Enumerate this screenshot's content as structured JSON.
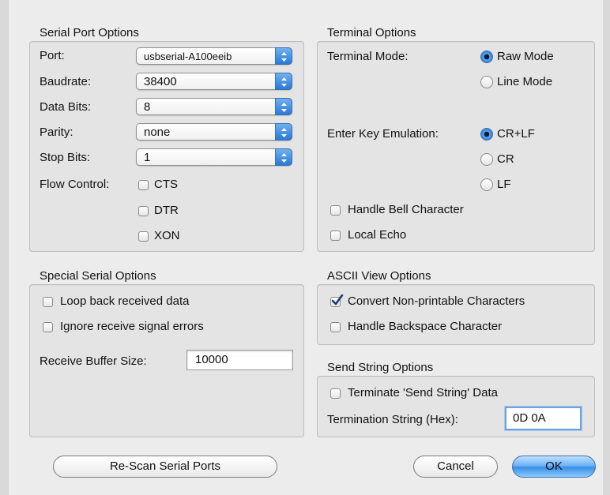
{
  "serial_port": {
    "title": "Serial Port Options",
    "port_label": "Port:",
    "port_value": "usbserial-A100eeib",
    "baudrate_label": "Baudrate:",
    "baudrate_value": "38400",
    "databits_label": "Data Bits:",
    "databits_value": "8",
    "parity_label": "Parity:",
    "parity_value": "none",
    "stopbits_label": "Stop Bits:",
    "stopbits_value": "1",
    "flow_label": "Flow Control:",
    "flow": [
      {
        "label": "CTS",
        "checked": false
      },
      {
        "label": "DTR",
        "checked": false
      },
      {
        "label": "XON",
        "checked": false
      }
    ]
  },
  "terminal": {
    "title": "Terminal Options",
    "mode_label": "Terminal Mode:",
    "mode_raw": "Raw Mode",
    "mode_line": "Line Mode",
    "mode_selected": "Raw Mode",
    "enter_label": "Enter Key Emulation:",
    "enter_crlf": "CR+LF",
    "enter_cr": "CR",
    "enter_lf": "LF",
    "enter_selected": "CR+LF",
    "bell_label": "Handle Bell Character",
    "bell_checked": false,
    "echo_label": "Local Echo",
    "echo_checked": false
  },
  "special": {
    "title": "Special Serial Options",
    "loopback_label": "Loop back received data",
    "loopback_checked": false,
    "ignore_label": "Ignore receive signal errors",
    "ignore_checked": false,
    "buffer_label": "Receive Buffer Size:",
    "buffer_value": "10000"
  },
  "ascii": {
    "title": "ASCII View Options",
    "convert_label": "Convert Non-printable Characters",
    "convert_checked": true,
    "backspace_label": "Handle Backspace Character",
    "backspace_checked": false
  },
  "send_string": {
    "title": "Send String Options",
    "terminate_label": "Terminate 'Send String' Data",
    "terminate_checked": false,
    "termination_label": "Termination String (Hex):",
    "termination_value": "0D 0A"
  },
  "buttons": {
    "rescan": "Re-Scan Serial Ports",
    "cancel": "Cancel",
    "ok": "OK"
  },
  "colors": {
    "accent": "#3c8ee8",
    "background": "#ececec"
  }
}
